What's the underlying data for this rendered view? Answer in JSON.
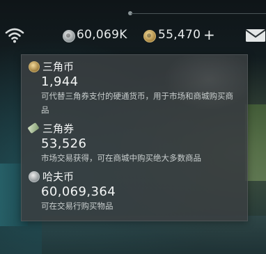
{
  "topbar": {
    "wifi_icon": "wifi-icon",
    "haf_coin_value": "60,069K",
    "triangle_coin_value": "55,470",
    "plus_label": "+",
    "mail_icon": "mail-icon"
  },
  "tooltip": {
    "sections": [
      {
        "icon": "gold-coin-icon",
        "name": "三角币",
        "amount": "1,944",
        "description": "可代替三角券支付的硬通货币，用于市场和商城购买商品"
      },
      {
        "icon": "ticket-icon",
        "name": "三角券",
        "amount": "53,526",
        "description": "市场交易获得，可在商城中购买绝大多数商品"
      },
      {
        "icon": "silver-coin-icon",
        "name": "哈夫币",
        "amount": "60,069,364",
        "description": "可在交易行购买物品"
      }
    ]
  },
  "colors": {
    "panel_bg": "#3a3f41",
    "text_primary": "#f1f3f3",
    "text_secondary": "#c8cdcd",
    "gold": "#cbae6c",
    "silver": "#b9bfc1"
  }
}
